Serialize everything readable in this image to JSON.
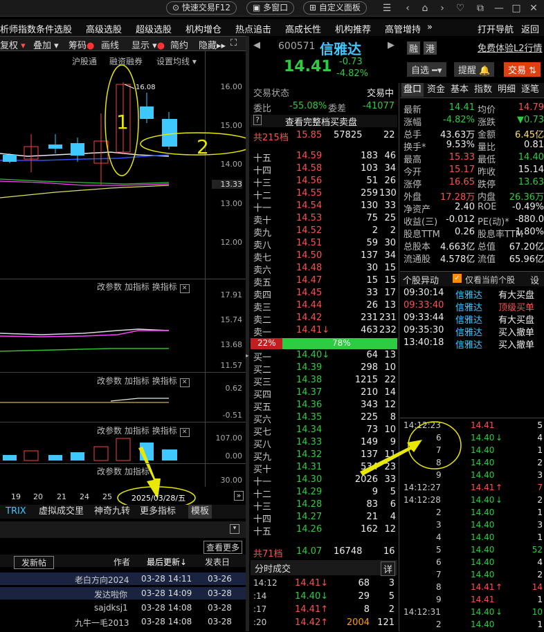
{
  "topbar": {
    "quick_trade": "快速交易F12",
    "multi_window": "多窗口",
    "custom_panel": "自定义面板"
  },
  "menu": [
    "析师指数",
    "条件选股",
    "高级选股",
    "超级选股",
    "机构增仓",
    "热点追击",
    "高成长性",
    "机构推荐",
    "高管增持",
    "»",
    "打开导航",
    "返回"
  ],
  "toolbar": {
    "fq": "复权",
    "overlay": "叠加",
    "chips": "筹码",
    "draw": "画线",
    "display": "显示",
    "brief": "简约",
    "hide": "隐藏"
  },
  "chart_header": {
    "hsgt": "沪股通",
    "margin": "融资融券",
    "set_ma": "设置均线"
  },
  "chart_data": {
    "type": "candlestick",
    "x": [
      "19",
      "20",
      "21",
      "24",
      "25",
      "2025/03/28/五"
    ],
    "y_ticks": [
      "16.00",
      "15.00",
      "14.00",
      "13.33",
      "13.00",
      "12.00"
    ],
    "high_label": "16.08",
    "ind1_ticks": [
      "17.91",
      "15.74",
      "13.68",
      "11.57"
    ],
    "ind2_ticks": [
      "0.62",
      "-0.51"
    ],
    "ind3_ticks": [
      "107.00",
      "0.00",
      "30.00"
    ]
  },
  "annotations": {
    "a1": "1",
    "a2": "2"
  },
  "indicator_controls": {
    "change_param": "改参数",
    "add_ind": "加指标",
    "switch_ind": "换指标"
  },
  "bottom_tabs": [
    "TRIX",
    "虚拟成交里",
    "神奇九转",
    "更多指标",
    "模板"
  ],
  "forum": {
    "post_btn": "发新帖",
    "author_h": "作者",
    "updated_h": "最后更新↓",
    "posted_h": "发表日",
    "more": "查看更多",
    "rows": [
      [
        "老白方向2024",
        "03-28 14:11",
        "03-26"
      ],
      [
        "发达啦你",
        "03-28 14:09",
        "03-28"
      ],
      [
        "sajdksj1",
        "03-28 14:08",
        "03-28"
      ],
      [
        "九牛一毛2013",
        "03-28 14:08",
        "03-28"
      ]
    ]
  },
  "stock": {
    "code": "600571",
    "name": "信雅达",
    "price": "14.41",
    "change": "-0.73",
    "pct": "-4.82%",
    "rong": "融",
    "gang": "港",
    "free_l2": "免费体验L2行情",
    "zixuan": "自选",
    "remind": "提醒",
    "trade": "交易"
  },
  "status": {
    "label": "交易状态",
    "value": "交易中",
    "weibi_l": "委比",
    "weibi": "-55.08%",
    "weicha_l": "委差",
    "weicha": "-41077",
    "full_btn": "查看完整档买卖盘",
    "total_l": "共215档",
    "total_p": "15.85",
    "total_v": "57825",
    "total_n": "22"
  },
  "asks": [
    [
      "十五",
      "14.59",
      "183",
      "46"
    ],
    [
      "十四",
      "14.58",
      "103",
      "34"
    ],
    [
      "十三",
      "14.56",
      "51",
      "26"
    ],
    [
      "十二",
      "14.55",
      "259",
      "130"
    ],
    [
      "十一",
      "14.54",
      "130",
      "33"
    ],
    [
      "卖十",
      "14.53",
      "75",
      "25"
    ],
    [
      "卖九",
      "14.52",
      "2",
      "2"
    ],
    [
      "卖八",
      "14.51",
      "59",
      "30"
    ],
    [
      "卖七",
      "14.50",
      "137",
      "34"
    ],
    [
      "卖六",
      "14.48",
      "30",
      "15"
    ],
    [
      "卖五",
      "14.47",
      "15",
      "15"
    ],
    [
      "卖四",
      "14.45",
      "33",
      "17"
    ],
    [
      "卖三",
      "14.44",
      "26",
      "13"
    ],
    [
      "卖二",
      "14.42",
      "231",
      "231"
    ],
    [
      "卖一",
      "14.41",
      "463",
      "232"
    ]
  ],
  "bar": {
    "left": "22%",
    "right": "78%"
  },
  "bids": [
    [
      "买一",
      "14.40",
      "64",
      "13"
    ],
    [
      "买二",
      "14.39",
      "298",
      "10"
    ],
    [
      "买三",
      "14.38",
      "1215",
      "22"
    ],
    [
      "买四",
      "14.37",
      "210",
      "14"
    ],
    [
      "买五",
      "14.36",
      "343",
      "12"
    ],
    [
      "买六",
      "14.35",
      "225",
      "8"
    ],
    [
      "买七",
      "14.34",
      "73",
      "10"
    ],
    [
      "买八",
      "14.33",
      "149",
      "9"
    ],
    [
      "买九",
      "14.32",
      "137",
      "11"
    ],
    [
      "买十",
      "14.31",
      "534",
      "23"
    ],
    [
      "十一",
      "14.30",
      "2026",
      "33"
    ],
    [
      "十二",
      "14.29",
      "9",
      "5"
    ],
    [
      "十三",
      "14.28",
      "83",
      "6"
    ],
    [
      "十四",
      "14.27",
      "21",
      "4"
    ],
    [
      "十五",
      "14.26",
      "162",
      "12"
    ]
  ],
  "bid_total": {
    "label": "共71档",
    "p": "14.07",
    "v": "16748",
    "n": "16"
  },
  "fenshi": {
    "title": "分时成交",
    "detail": "详",
    "rows": [
      [
        "14:12",
        "14.41",
        "68",
        "3"
      ],
      [
        ":14",
        "14.40",
        "29",
        "5"
      ],
      [
        ":17",
        "14.41",
        "8",
        "2"
      ],
      [
        ":20",
        "14.42",
        "2004",
        "121"
      ]
    ]
  },
  "tabs": [
    "盘口",
    "资金",
    "基本",
    "指数",
    "明细",
    "逐笔"
  ],
  "quote": [
    [
      "最新",
      "14.41",
      "均价",
      "14.79"
    ],
    [
      "涨幅",
      "-4.82%",
      "涨跌",
      "▼0.73"
    ],
    [
      "总手",
      "43.63万",
      "金额",
      "6.45亿"
    ],
    [
      "换手*",
      "9.53%",
      "量比",
      "0.81"
    ],
    [
      "最高",
      "15.33",
      "最低",
      "14.40"
    ],
    [
      "今开",
      "15.17",
      "昨收",
      "15.14"
    ],
    [
      "涨停",
      "16.65",
      "跌停",
      "13.63"
    ],
    [
      "外盘",
      "17.28万",
      "内盘",
      "26.36万"
    ],
    [
      "净资产",
      "2.40",
      "ROE",
      "-0.49%"
    ],
    [
      "收益(三)",
      "-0.012",
      "PE(动)*",
      "-880.0"
    ],
    [
      "股息TTM",
      "0.26",
      "股息率TTM",
      "1.80%"
    ],
    [
      "总股本",
      "4.663亿",
      "总值",
      "67.20亿"
    ],
    [
      "流通股",
      "4.578亿",
      "流值",
      "65.96亿"
    ]
  ],
  "anomaly": {
    "title": "个股异动",
    "only_current": "仅看当前个股",
    "set": "设",
    "rows": [
      [
        "09:30:14",
        "信雅达",
        "有大买盘"
      ],
      [
        "09:33:40",
        "信雅达",
        "顶级买单"
      ],
      [
        "09:33:44",
        "信雅达",
        "有大买盘"
      ],
      [
        "09:35:30",
        "信雅达",
        "买入撤单"
      ],
      [
        "13:40:18",
        "信雅达",
        "买入撤单"
      ]
    ]
  },
  "ticks": [
    [
      "14:12:23",
      "14.41",
      "",
      "5"
    ],
    [
      "6",
      "14.40",
      "↓",
      "4"
    ],
    [
      "7",
      "14.40",
      "",
      "1"
    ],
    [
      "8",
      "14.40",
      "",
      "2"
    ],
    [
      "9",
      "14.40",
      "",
      "3"
    ],
    [
      "14:12:27",
      "14.41",
      "↑",
      "7"
    ],
    [
      "14:12:28",
      "14.40",
      "↓",
      "2"
    ],
    [
      "2",
      "14.40",
      "",
      "1"
    ],
    [
      "3",
      "14.40",
      "",
      "3"
    ],
    [
      "4",
      "14.40",
      "",
      "1"
    ],
    [
      "5",
      "14.40",
      "",
      "52"
    ],
    [
      "6",
      "14.40",
      "",
      "4"
    ],
    [
      "7",
      "14.40",
      "",
      "2"
    ],
    [
      "8",
      "14.41",
      "↑",
      "14"
    ],
    [
      "9",
      "14.41",
      "",
      "1"
    ],
    [
      "14:12:31",
      "14.40",
      "↓",
      "10"
    ],
    [
      "2",
      "14.40",
      "",
      "1"
    ]
  ]
}
